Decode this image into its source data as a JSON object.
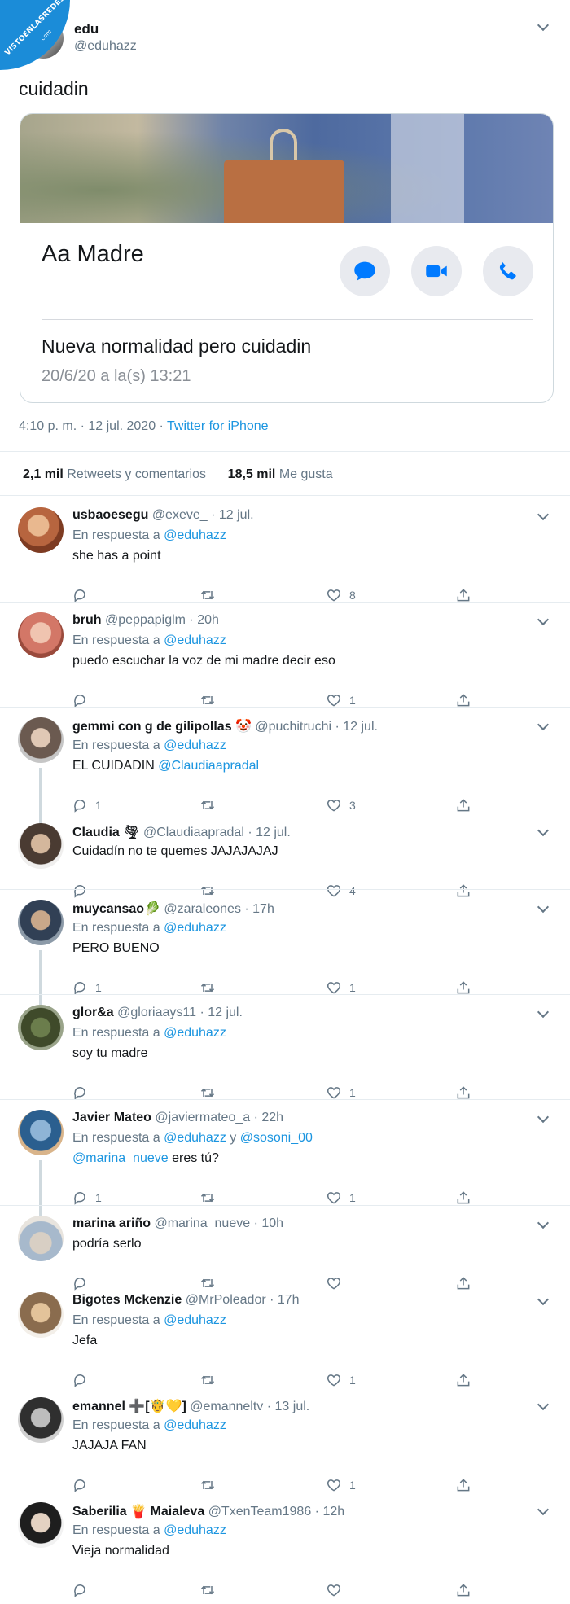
{
  "watermark": {
    "line1": "VISTOENLASREDES",
    "line2": ".com"
  },
  "tweet": {
    "name": "edu",
    "handle": "@eduhazz",
    "text": "cuidadin",
    "card": {
      "contact_name": "Aa Madre",
      "message": "Nueva normalidad pero cuidadin",
      "date": "20/6/20 a la(s) 13:21",
      "buttons": [
        "message-icon",
        "video-icon",
        "phone-icon"
      ]
    },
    "time": "4:10 p. m. · 12 jul. 2020 · ",
    "source": "Twitter for iPhone",
    "retweets_count": "2,1 mil",
    "retweets_label": "Retweets y comentarios",
    "likes_count": "18,5 mil",
    "likes_label": "Me gusta"
  },
  "replies": [
    {
      "name": "usbaoesegu",
      "handle": "@exeve_ · 12 jul.",
      "in_reply_prefix": "En respuesta a ",
      "in_reply_to": "@eduhazz",
      "in_reply_mid": "",
      "in_reply_to2": "",
      "text": "she has a point",
      "text_link": "",
      "replies": "",
      "likes": "8"
    },
    {
      "name": "bruh",
      "handle": "@peppapiglm · 20h",
      "in_reply_prefix": "En respuesta a ",
      "in_reply_to": "@eduhazz",
      "in_reply_mid": "",
      "in_reply_to2": "",
      "text": "puedo escuchar la voz de mi madre decir eso",
      "text_link": "",
      "replies": "",
      "likes": "1"
    },
    {
      "name": "gemmi con g de gilipollas 🤡",
      "handle": "@puchitruchi · 12 jul.",
      "in_reply_prefix": "En respuesta a ",
      "in_reply_to": "@eduhazz",
      "in_reply_mid": "",
      "in_reply_to2": "",
      "text": "EL CUIDADIN ",
      "text_link": "@Claudiaapradal",
      "replies": "1",
      "likes": "3"
    },
    {
      "name": "Claudia 🌪",
      "handle": "@Claudiaapradal · 12 jul.",
      "in_reply_prefix": "",
      "in_reply_to": "",
      "in_reply_mid": "",
      "in_reply_to2": "",
      "text": "Cuidadín no te quemes JAJAJAJAJ",
      "text_link": "",
      "replies": "",
      "likes": "4"
    },
    {
      "name": "muycansao🥬",
      "handle": "@zaraleones · 17h",
      "in_reply_prefix": "En respuesta a ",
      "in_reply_to": "@eduhazz",
      "in_reply_mid": "",
      "in_reply_to2": "",
      "text": "PERO BUENO",
      "text_link": "",
      "replies": "1",
      "likes": "1"
    },
    {
      "name": "glor&a",
      "handle": "@gloriaays11 · 12 jul.",
      "in_reply_prefix": "En respuesta a ",
      "in_reply_to": "@eduhazz",
      "in_reply_mid": "",
      "in_reply_to2": "",
      "text": "soy tu madre",
      "text_link": "",
      "replies": "",
      "likes": "1"
    },
    {
      "name": "Javier Mateo",
      "handle": "@javiermateo_a · 22h",
      "in_reply_prefix": "En respuesta a ",
      "in_reply_to": "@eduhazz",
      "in_reply_mid": " y ",
      "in_reply_to2": "@sosoni_00",
      "text_link_first": "@marina_nueve",
      "text": " eres tú?",
      "text_link": "",
      "replies": "1",
      "likes": "1"
    },
    {
      "name": "marina ariño",
      "handle": "@marina_nueve · 10h",
      "in_reply_prefix": "",
      "in_reply_to": "",
      "in_reply_mid": "",
      "in_reply_to2": "",
      "text": "podría serlo",
      "text_link": "",
      "replies": "",
      "likes": ""
    },
    {
      "name": "Bigotes Mckenzie",
      "handle": "@MrPoleador · 17h",
      "in_reply_prefix": "En respuesta a ",
      "in_reply_to": "@eduhazz",
      "in_reply_mid": "",
      "in_reply_to2": "",
      "text": "Jefa",
      "text_link": "",
      "replies": "",
      "likes": "1"
    },
    {
      "name": "emannel ➕[🤴💛]",
      "handle": "@emanneltv · 13 jul.",
      "in_reply_prefix": "En respuesta a ",
      "in_reply_to": "@eduhazz",
      "in_reply_mid": "",
      "in_reply_to2": "",
      "text": "JAJAJA FAN",
      "text_link": "",
      "replies": "",
      "likes": "1"
    },
    {
      "name": "Saberilia 🍟 Maialeva",
      "handle": "@TxenTeam1986 · 12h",
      "in_reply_prefix": "En respuesta a ",
      "in_reply_to": "@eduhazz",
      "in_reply_mid": "",
      "in_reply_to2": "",
      "text": "Vieja normalidad",
      "text_link": "",
      "replies": "",
      "likes": ""
    }
  ],
  "colors": {
    "link": "#1b95e0",
    "secondary": "#657786",
    "ios_blue": "#007aff",
    "watermark": "#1b8cd8"
  }
}
